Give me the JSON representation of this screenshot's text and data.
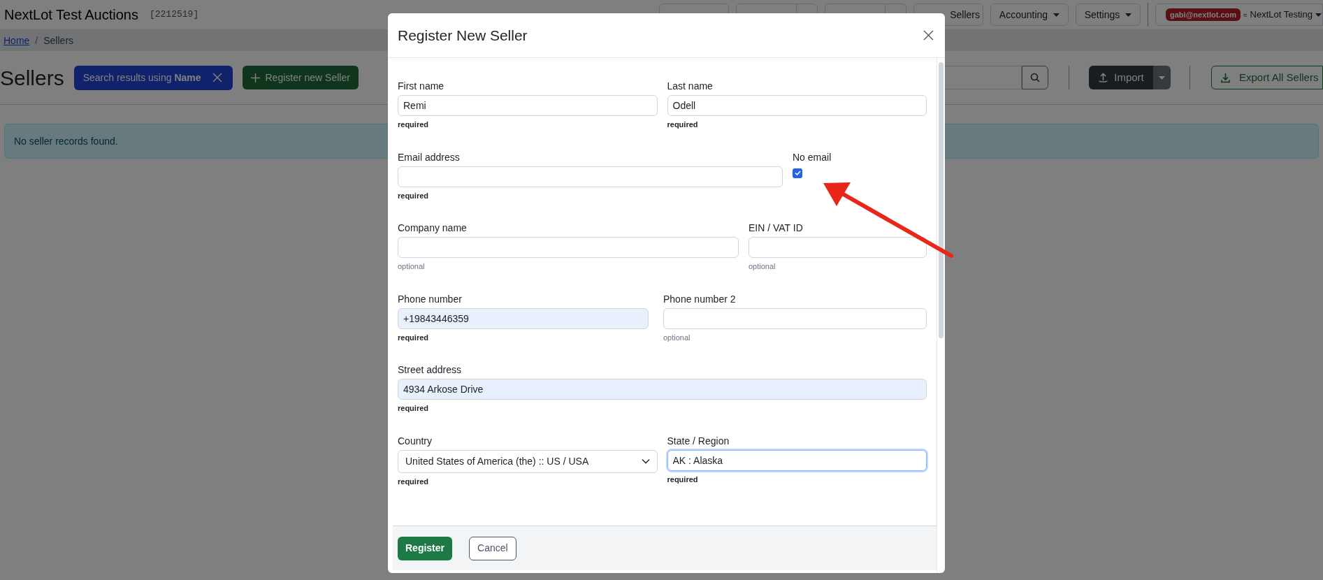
{
  "app": {
    "title": "NextLot Test Auctions",
    "account_id": "[2212519]"
  },
  "nav": [
    {
      "kind": "plain"
    },
    {
      "kind": "split"
    },
    {
      "kind": "split"
    },
    {
      "kind": "plain",
      "label": "Sellers"
    },
    {
      "kind": "dropdown",
      "label": "Accounting"
    },
    {
      "kind": "dropdown",
      "label": "Settings"
    }
  ],
  "user": {
    "email": "gabi@nextlot.com",
    "separator": "≈",
    "org": "NextLot Testing"
  },
  "breadcrumb": [
    {
      "label": "Home",
      "link": true
    },
    {
      "separator": "/",
      "label": "Sellers",
      "link": false
    }
  ],
  "page": {
    "heading": "Sellers",
    "filter_chip": "Search results using **Name**",
    "register_button": "Register new Seller",
    "import_button": "Import",
    "export_button": "Export All Sellers"
  },
  "alert": "No seller records found.",
  "modal": {
    "title": "Register New Seller",
    "rows": [
      [
        {
          "kind": "text",
          "label": "First name",
          "value": "Remi",
          "hint": "required",
          "required": true,
          "autofilled": false,
          "focused": false
        },
        {
          "kind": "text",
          "label": "Last name",
          "value": "Odell",
          "hint": "required",
          "required": true,
          "autofilled": false,
          "focused": false
        }
      ],
      [
        {
          "kind": "text",
          "label": "Email address",
          "hint": "required",
          "required": true,
          "autofilled": false,
          "focused": false
        },
        {
          "kind": "checkbox",
          "label": "No email",
          "checked": true
        }
      ],
      [
        {
          "kind": "text",
          "label": "Company name",
          "hint": "optional",
          "required": false,
          "autofilled": false,
          "focused": false
        },
        {
          "kind": "text",
          "label": "EIN / VAT ID",
          "hint": "optional",
          "required": false,
          "autofilled": false,
          "focused": false
        }
      ],
      [
        {
          "kind": "text",
          "label": "Phone number",
          "value": "+19843446359",
          "hint": "required",
          "required": true,
          "autofilled": true,
          "focused": false
        },
        {
          "kind": "text",
          "label": "Phone number 2",
          "hint": "optional",
          "required": false,
          "autofilled": false,
          "focused": false
        }
      ],
      [
        {
          "kind": "text",
          "label": "Street address",
          "value": "4934 Arkose Drive",
          "hint": "required",
          "required": true,
          "autofilled": true,
          "focused": false
        }
      ],
      [
        {
          "kind": "select",
          "label": "Country",
          "value": "United States of America (the) :: US / USA",
          "hint": "required",
          "required": true
        },
        {
          "kind": "text",
          "label": "State / Region",
          "value": "AK : Alaska",
          "hint": "required",
          "required": true,
          "autofilled": false,
          "focused": true
        }
      ]
    ],
    "buttons": [
      {
        "label": "Register",
        "primary": true
      },
      {
        "label": "Cancel",
        "primary": false
      }
    ]
  }
}
